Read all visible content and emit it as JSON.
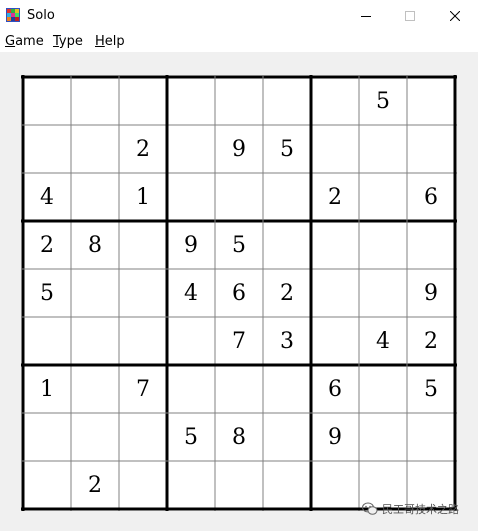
{
  "window": {
    "title": "Solo",
    "app_icon": "colorful-grid-icon"
  },
  "menu": {
    "game_label": "Game",
    "type_label": "Type",
    "help_label": "Help"
  },
  "puzzle": {
    "rows": [
      [
        "",
        "",
        "",
        "",
        "",
        "",
        "",
        "5",
        ""
      ],
      [
        "",
        "",
        "2",
        "",
        "9",
        "5",
        "",
        "",
        ""
      ],
      [
        "4",
        "",
        "1",
        "",
        "",
        "",
        "2",
        "",
        "6"
      ],
      [
        "2",
        "8",
        "",
        "9",
        "5",
        "",
        "",
        "",
        ""
      ],
      [
        "5",
        "",
        "",
        "4",
        "6",
        "2",
        "",
        "",
        "9"
      ],
      [
        "",
        "",
        "",
        "",
        "7",
        "3",
        "",
        "4",
        "2"
      ],
      [
        "1",
        "",
        "7",
        "",
        "",
        "",
        "6",
        "",
        "5"
      ],
      [
        "",
        "",
        "",
        "5",
        "8",
        "",
        "9",
        "",
        ""
      ],
      [
        "",
        "2",
        "",
        "",
        "",
        "",
        "",
        "",
        ""
      ]
    ]
  },
  "watermark": {
    "icon": "wechat-icon",
    "text": "民工哥技术之路"
  }
}
